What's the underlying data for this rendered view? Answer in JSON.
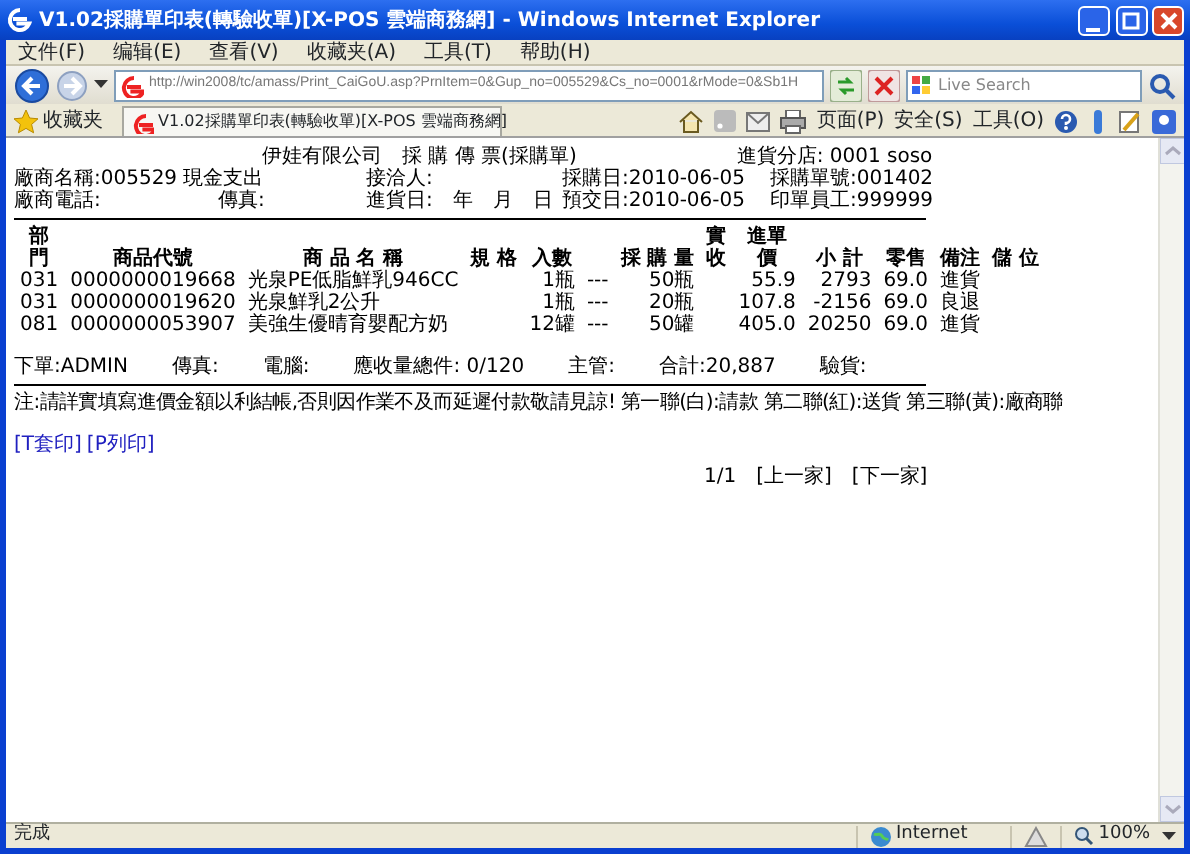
{
  "window": {
    "title": "V1.02採購單印表(轉驗收單)[X-POS 雲端商務網] - Windows Internet Explorer"
  },
  "menu": [
    "文件(F)",
    "编辑(E)",
    "查看(V)",
    "收藏夹(A)",
    "工具(T)",
    "帮助(H)"
  ],
  "address_bar": {
    "url": "http://win2008/tc/amass/Print_CaiGoU.asp?PrnItem=0&Gup_no=005529&Cs_no=0001&rMode=0&Sb1H"
  },
  "search": {
    "placeholder": "Live Search"
  },
  "favorites_bar": {
    "label": "收藏夹",
    "tab": "V1.02採購單印表(轉驗收單)[X-POS 雲端商務網]"
  },
  "command_bar": [
    "页面(P)",
    "安全(S)",
    "工具(O)"
  ],
  "document": {
    "title": "伊娃有限公司　採 購 傳 票(採購單)",
    "branch": "進貨分店: 0001 soso",
    "info_rows": [
      [
        "廠商名稱:005529 現金支出",
        "接洽人:",
        "採購日:2010-06-05",
        "採購單號:001402"
      ],
      [
        "廠商電話:",
        "傳真:",
        "進貨日:　年　月　日",
        "預交日:2010-06-05",
        "印單員工:999999"
      ]
    ],
    "columns": [
      "部門",
      "商品代號",
      "商 品 名 稱",
      "規 格",
      "入數",
      "",
      "採 購 量",
      "實收",
      "進單價",
      "小 計",
      "零售",
      "備注",
      "儲 位"
    ],
    "rows": [
      [
        "031",
        "0000000019668",
        "光泉PE低脂鮮乳946CC",
        "",
        "1瓶",
        "---",
        "50瓶",
        "",
        "55.9",
        "2793",
        "69.0",
        "進貨",
        ""
      ],
      [
        "031",
        "0000000019620",
        "光泉鮮乳2公升",
        "",
        "1瓶",
        "---",
        "20瓶",
        "",
        "107.8",
        "-2156",
        "69.0",
        "良退",
        ""
      ],
      [
        "081",
        "0000000053907",
        "美強生優晴育嬰配方奶",
        "",
        "12罐",
        "---",
        "50罐",
        "",
        "405.0",
        "20250",
        "69.0",
        "進貨",
        ""
      ]
    ],
    "footer_fields": [
      "下單:ADMIN",
      "傳真:",
      "電腦:",
      "應收量總件: 0/120",
      "主管:",
      "合計:20,887",
      "驗貨:"
    ],
    "note": "注:請詳實填寫進價金額以利結帳,否則因作業不及而延遲付款敬請見諒! 第一聯(白):請款 第二聯(紅):送貨 第三聯(黃):廠商聯",
    "print_links": [
      "[T套印]",
      "[P列印]"
    ],
    "pager": {
      "page": "1/1",
      "links": [
        "[上一家]",
        "[下一家]"
      ]
    }
  },
  "status_bar": {
    "text": "完成",
    "zone": "Internet",
    "zoom": "100%"
  }
}
